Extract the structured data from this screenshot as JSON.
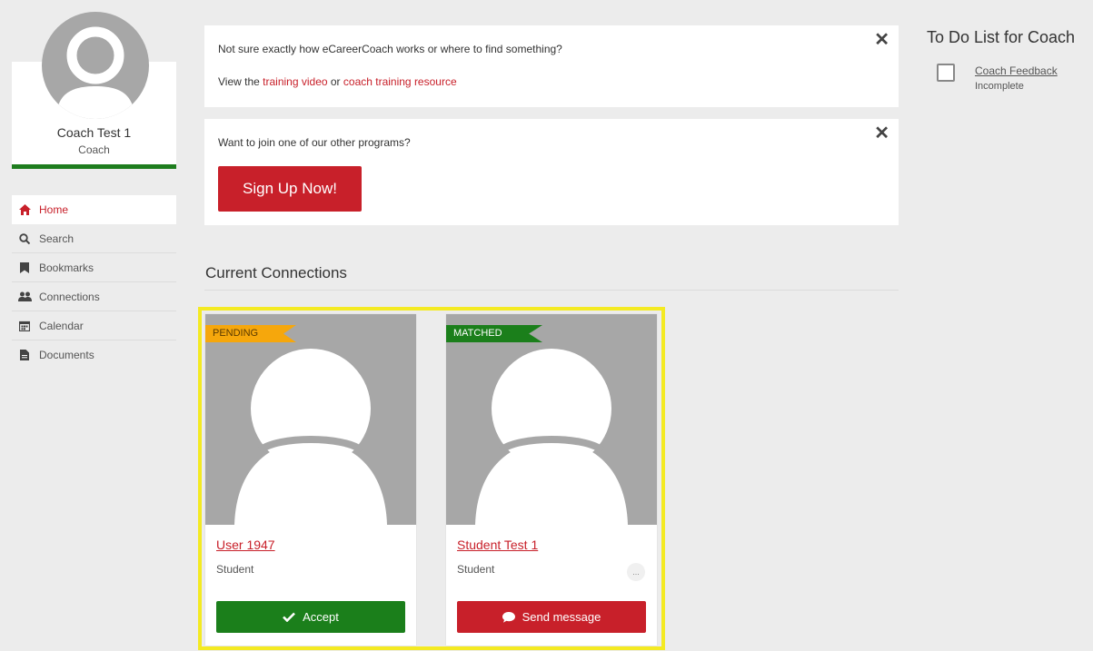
{
  "profile": {
    "name": "Coach Test 1",
    "role": "Coach"
  },
  "nav": {
    "items": [
      {
        "label": "Home",
        "icon": "home-icon"
      },
      {
        "label": "Search",
        "icon": "search-icon"
      },
      {
        "label": "Bookmarks",
        "icon": "bookmark-icon"
      },
      {
        "label": "Connections",
        "icon": "users-icon"
      },
      {
        "label": "Calendar",
        "icon": "calendar-icon"
      },
      {
        "label": "Documents",
        "icon": "document-icon"
      }
    ]
  },
  "notices": {
    "help": {
      "line1": "Not sure exactly how eCareerCoach works or where to find something?",
      "prefix": "View the ",
      "link1": "training video",
      "middle": " or ",
      "link2": "coach training resource"
    },
    "programs": {
      "prompt": "Want to join one of our other programs?",
      "button": "Sign Up Now!"
    },
    "close_symbol": "✕"
  },
  "connections": {
    "title": "Current Connections",
    "cards": [
      {
        "status": "PENDING",
        "name": "User 1947",
        "role": "Student",
        "action": "Accept"
      },
      {
        "status": "MATCHED",
        "name": "Student Test 1",
        "role": "Student",
        "action": "Send message",
        "more": "..."
      }
    ]
  },
  "todo": {
    "title": "To Do List for Coach",
    "items": [
      {
        "label": "Coach Feedback",
        "status": "Incomplete"
      }
    ]
  },
  "colors": {
    "accent_red": "#c8202a",
    "success_green": "#1b7f1b",
    "pending_orange": "#f6a70c",
    "highlight_yellow": "#f4ea22"
  }
}
